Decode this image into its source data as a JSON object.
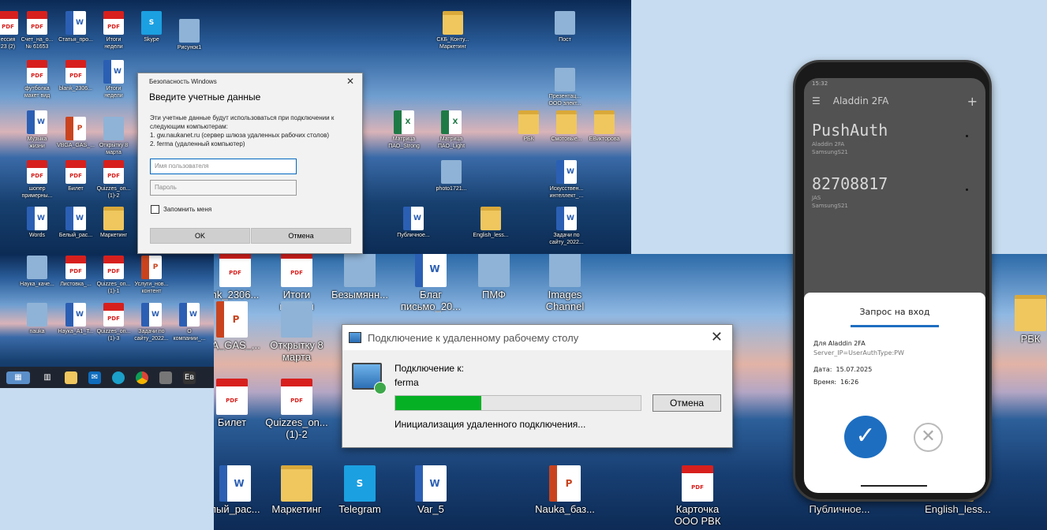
{
  "desktop1_icons": [
    {
      "label": "ессия\n23 (2)",
      "type": "pdf"
    },
    {
      "label": "Счет_на_о...\n№ 61653",
      "type": "pdf"
    },
    {
      "label": "Статья_про...",
      "type": "word"
    },
    {
      "label": "Итоги\nнедели",
      "type": "pdf"
    },
    {
      "label": "Skype",
      "type": "skype"
    },
    {
      "label": "Рисунок1",
      "type": "img"
    },
    {
      "label": "СКБ_Конту...\nМаркетинг",
      "type": "folder"
    },
    {
      "label": "Пост",
      "type": "img"
    },
    {
      "label": "футболка\nмакет вид",
      "type": "pdf"
    },
    {
      "label": "blank_2306...",
      "type": "pdf"
    },
    {
      "label": "Итоги\nнедели",
      "type": "word"
    },
    {
      "label": "Презентац...\nООО элект...",
      "type": "img"
    },
    {
      "label": "Музыка\nжизни",
      "type": "word"
    },
    {
      "label": "VBGA_GAS_...",
      "type": "ppt"
    },
    {
      "label": "Открытку 8\nмарта",
      "type": "img"
    },
    {
      "label": "Матрица\nПАО_Strong",
      "type": "xl"
    },
    {
      "label": "Матрица\nПАО_Light",
      "type": "xl"
    },
    {
      "label": "РБК",
      "type": "folder"
    },
    {
      "label": "Смотовые...",
      "type": "folder"
    },
    {
      "label": "EВикторова",
      "type": "folder"
    },
    {
      "label": "шопер\nпримерны...",
      "type": "pdf"
    },
    {
      "label": "Билет",
      "type": "pdf"
    },
    {
      "label": "Quizzes_on...\n(1)-2",
      "type": "pdf"
    },
    {
      "label": "photo1721...",
      "type": "img"
    },
    {
      "label": "Искусствен...\nинтеллект_...",
      "type": "word"
    },
    {
      "label": "Words",
      "type": "word"
    },
    {
      "label": "Белый_рас...",
      "type": "word"
    },
    {
      "label": "Маркетинг",
      "type": "folder"
    },
    {
      "label": "Публичное...",
      "type": "word"
    },
    {
      "label": "English_less...",
      "type": "folder"
    },
    {
      "label": "Задачи по\nсайту_2022...",
      "type": "word"
    }
  ],
  "desktop2_icons": [
    {
      "label": "Наука_каче...",
      "type": "img"
    },
    {
      "label": "Листовка_...",
      "type": "pdf"
    },
    {
      "label": "Quizzes_on...\n(1)-1",
      "type": "pdf"
    },
    {
      "label": "Услуги_нов...\nконтент",
      "type": "ppt"
    },
    {
      "label": "nauka",
      "type": "img"
    },
    {
      "label": "Наука_А1_Т...",
      "type": "word"
    },
    {
      "label": "Quizzes_on...\n(1)-3",
      "type": "pdf"
    },
    {
      "label": "Задачи по\nсайту_2022...",
      "type": "word"
    },
    {
      "label": "О\nкомпании_...",
      "type": "word"
    }
  ],
  "desktop3_icons": [
    {
      "label": "nk_2306...",
      "type": "pdf"
    },
    {
      "label": "Итоги\nнедели",
      "type": "pdf"
    },
    {
      "label": "Безымянн...",
      "type": "img"
    },
    {
      "label": "Благ\nписьмо_20...",
      "type": "word"
    },
    {
      "label": "ПМФ",
      "type": "img"
    },
    {
      "label": "Images\nChannel",
      "type": "img"
    },
    {
      "label": "GA_GAS_...",
      "type": "ppt"
    },
    {
      "label": "Открытку 8\nмарта",
      "type": "img"
    },
    {
      "label": "РБК",
      "type": "folder"
    },
    {
      "label": "Билет",
      "type": "pdf"
    },
    {
      "label": "Quizzes_on...\n(1)-2",
      "type": "pdf"
    },
    {
      "label": "лый_рас...",
      "type": "word"
    },
    {
      "label": "Маркетинг",
      "type": "folder"
    },
    {
      "label": "Telegram",
      "type": "skype"
    },
    {
      "label": "Var_5",
      "type": "word"
    },
    {
      "label": "Nauka_баз...",
      "type": "ppt"
    },
    {
      "label": "Карточка\nООО РВК",
      "type": "pdf"
    },
    {
      "label": "Публичное...",
      "type": "word"
    },
    {
      "label": "English_less...",
      "type": "folder"
    }
  ],
  "security_dialog": {
    "caption": "Безопасность Windows",
    "heading": "Введите учетные данные",
    "description": "Эти учетные данные будут использоваться при подключении к следующим компьютерам:",
    "line1": "1. gw.naukanet.ru (сервер шлюза удаленных рабочих столов)",
    "line2": "2. ferma (удаленный компьютер)",
    "username_placeholder": "Имя пользователя",
    "password_placeholder": "Пароль",
    "remember_label": "Запомнить меня",
    "ok_label": "OK",
    "cancel_label": "Отмена"
  },
  "rdp_dialog": {
    "title": "Подключение к удаленному рабочему столу",
    "connecting_label": "Подключение к:",
    "host": "ferma",
    "progress_percent": 35,
    "cancel_label": "Отмена",
    "status": "Инициализация удаленного подключения..."
  },
  "phone": {
    "time": "15:32",
    "app_title": "Aladdin 2FA",
    "accounts": [
      {
        "name": "PushAuth",
        "sub1": "Aladdin 2FA",
        "sub2": "SamsungS21"
      },
      {
        "name": "82708817",
        "sub1": "JAS",
        "sub2": "SamsungS21"
      }
    ],
    "sheet": {
      "title": "Запрос на вход",
      "for_label": "Для Aladdin 2FA",
      "server": "Server_IP=UserAuthType:PW",
      "date_label": "Дата:",
      "date": "15.07.2025",
      "time_label": "Время:",
      "time": "16:26"
    }
  },
  "colors": {
    "accent": "#1d6ec1",
    "progress": "#06b025",
    "pdf": "#d7201d",
    "word": "#2b5fb4"
  }
}
